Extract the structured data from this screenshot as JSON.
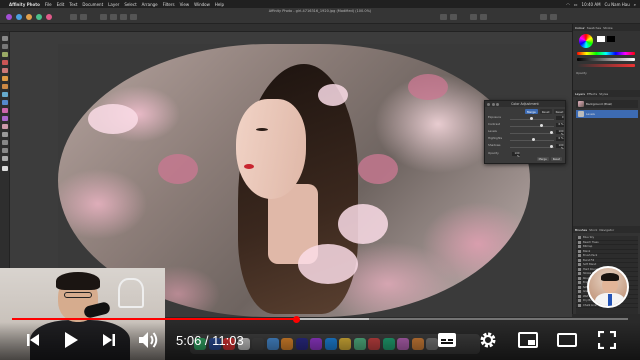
{
  "menubar": {
    "app_name": "Affinity Photo",
    "items": [
      "File",
      "Edit",
      "Text",
      "Document",
      "Layer",
      "Select",
      "Arrange",
      "Filters",
      "View",
      "Window",
      "Help"
    ],
    "clock": "10:40 AM",
    "user": "Cu Nam Hau"
  },
  "toolbar": {
    "document_title": "Affinity Photo - girl-4716316_1920.jpg (Modified) (100.0%)"
  },
  "dialog": {
    "title": "Color Adjustment",
    "tabs": [
      {
        "label": "Merge"
      },
      {
        "label": "Reset"
      },
      {
        "label": "Reset"
      }
    ],
    "rows": [
      {
        "label": "Exposure",
        "value": "0"
      },
      {
        "label": "Contrast",
        "value": "0 %"
      },
      {
        "label": "Levels",
        "value": "100 %"
      },
      {
        "label": "Highlights",
        "value": "0 %"
      },
      {
        "label": "Shadows",
        "value": "100 %"
      },
      {
        "label": "Opacity",
        "value": "100 %"
      }
    ],
    "buttons": [
      "Merge",
      "Reset"
    ]
  },
  "studio": {
    "tabs": [
      "Colour",
      "Swatches",
      "Stroke"
    ],
    "opacity_label": "Opacity",
    "layers_tabs": [
      "Layers",
      "Effects",
      "Styles"
    ],
    "layers": [
      {
        "name": "Background (Pixel)",
        "selected": false
      },
      {
        "name": "Levels",
        "selected": true
      }
    ],
    "assets_tabs": [
      "Brushes",
      "Stock",
      "Navigator"
    ],
    "list_items": [
      "Blue Sky",
      "Beach Trees",
      "Bitmap",
      "Blank",
      "Brush Pack",
      "Burst Fill",
      "Soft Blend",
      "Hard Round",
      "Stroke Fill",
      "Rough Edge",
      "Bright Round",
      "Soft Ellipse",
      "Grain Fill",
      "Wet Edges",
      "Dry Brush",
      "Chalk Line"
    ]
  },
  "player": {
    "current_time": "5:06",
    "separator": " / ",
    "duration": "11:03",
    "progress": 0.462,
    "buffered": 0.58
  },
  "colors": {
    "progress": "#ff0000",
    "accent": "#3d6bb3"
  }
}
